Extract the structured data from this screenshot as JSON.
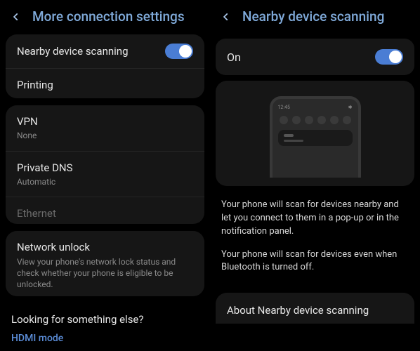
{
  "left": {
    "title": "More connection settings",
    "section1": {
      "nearby": "Nearby device scanning",
      "printing": "Printing"
    },
    "section2": {
      "vpn": "VPN",
      "vpn_sub": "None",
      "dns": "Private DNS",
      "dns_sub": "Automatic",
      "ethernet": "Ethernet"
    },
    "section3": {
      "unlock": "Network unlock",
      "unlock_sub": "View your phone's network lock status and check whether your phone is eligible to be unlocked."
    },
    "footer": {
      "prompt": "Looking for something else?",
      "link": "HDMI mode"
    }
  },
  "right": {
    "title": "Nearby device scanning",
    "status": "On",
    "desc1": "Your phone will scan for devices nearby and let you connect to them in a pop-up or in the notification panel.",
    "desc2": "Your phone will scan for devices even when Bluetooth is turned off.",
    "about": "About Nearby device scanning",
    "mock_time": "12:45"
  }
}
